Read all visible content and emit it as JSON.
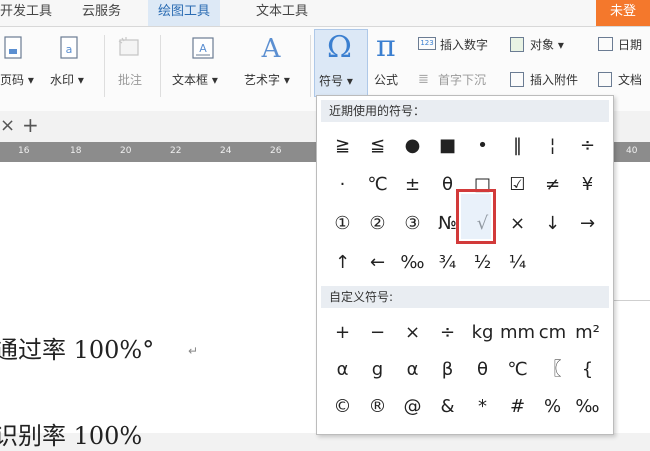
{
  "menu": {
    "tabs": [
      "开发工具",
      "云服务",
      "绘图工具",
      "文本工具"
    ],
    "active_tab": "绘图工具",
    "login": "未登"
  },
  "ribbon": {
    "page_number": "页码 ▾",
    "watermark": "水印 ▾",
    "comment": "批注",
    "textbox": "文本框 ▾",
    "wordart": "艺术字 ▾",
    "symbol": "符号 ▾",
    "formula": "公式",
    "insert_number": "插入数字",
    "object": "对象 ▾",
    "date": "日期",
    "drop_cap": "首字下沉",
    "attachment": "插入附件",
    "doc_part": "文档"
  },
  "tabs": {
    "close_glyph": "×",
    "add_glyph": "+"
  },
  "ruler": {
    "ticks": [
      "16",
      "18",
      "20",
      "22",
      "24",
      "26",
      "40"
    ]
  },
  "document": {
    "line1": "通过率 100%°",
    "line2": "识别率 100%"
  },
  "symbol_panel": {
    "recent_header": "近期使用的符号：",
    "recent_symbols": [
      "≧",
      "≦",
      "●",
      "■",
      "•",
      "‖",
      "¦",
      "÷",
      "·",
      "℃",
      "±",
      "θ",
      "□",
      "☑",
      "≠",
      "¥",
      "①",
      "②",
      "③",
      "№",
      "√",
      "×",
      "↓",
      "→",
      "↑",
      "←",
      "‰",
      "¾",
      "½",
      "¼"
    ],
    "selected_symbol": "√",
    "custom_header": "自定义符号:",
    "custom_symbols": [
      "+",
      "−",
      "×",
      "÷",
      "kg",
      "mm",
      "cm",
      "m²",
      "α",
      "g",
      "α",
      "β",
      "θ",
      "℃",
      "〖",
      "{",
      "©",
      "®",
      "@",
      "&",
      "*",
      "#",
      "%",
      "‰"
    ]
  },
  "colors": {
    "highlight": "#d23a3a",
    "active_tab_text": "#2b6cb3",
    "login_bg": "#f4782c"
  }
}
